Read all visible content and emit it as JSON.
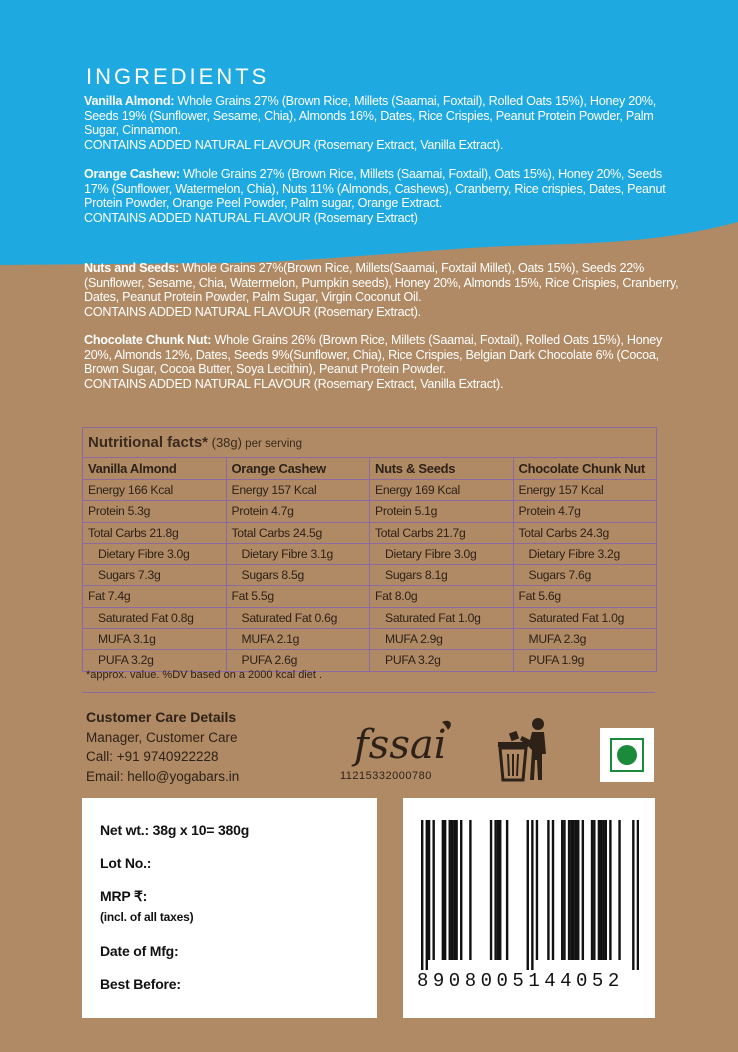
{
  "colors": {
    "blue": "#1ea9e1",
    "kraft": "#b08a64",
    "table_border": "#8c6aa0",
    "veg_green": "#1b8a3a"
  },
  "ingredients": {
    "title": "INGREDIENTS",
    "items": [
      {
        "name": "Vanilla Almond:",
        "text": " Whole Grains 27% (Brown Rice, Millets (Saamai, Foxtail), Rolled Oats 15%), Honey 20%, Seeds 19% (Sunflower, Sesame, Chia), Almonds 16%, Dates, Rice Crispies, Peanut Protein Powder, Palm Sugar, Cinnamon.",
        "contains": "CONTAINS ADDED NATURAL FLAVOUR (Rosemary Extract, Vanilla Extract)."
      },
      {
        "name": "Orange Cashew:",
        "text": " Whole Grains 27% (Brown Rice, Millets (Saamai, Foxtail), Oats 15%), Honey 20%, Seeds 17% (Sunflower, Watermelon, Chia), Nuts 11% (Almonds, Cashews), Cranberry, Rice crispies, Dates, Peanut Protein Powder, Orange Peel Powder, Palm sugar, Orange Extract.",
        "contains": "CONTAINS ADDED NATURAL FLAVOUR (Rosemary Extract)"
      },
      {
        "name": "Nuts and Seeds:",
        "text": " Whole Grains 27%(Brown Rice, Millets(Saamai, Foxtail Millet), Oats 15%), Seeds 22% (Sunflower, Sesame, Chia, Watermelon, Pumpkin seeds), Honey 20%, Almonds 15%, Rice Crispies, Cranberry, Dates, Peanut Protein Powder, Palm Sugar, Virgin Coconut Oil.",
        "contains": "CONTAINS ADDED NATURAL FLAVOUR (Rosemary Extract)."
      },
      {
        "name": "Chocolate Chunk Nut:",
        "text": " Whole Grains 26% (Brown Rice, Millets (Saamai, Foxtail), Rolled Oats 15%), Honey 20%, Almonds 12%, Dates, Seeds 9%(Sunflower, Chia), Rice Crispies, Belgian Dark Chocolate 6% (Cocoa, Brown Sugar, Cocoa Butter, Soya Lecithin), Peanut Protein Powder.",
        "contains": "CONTAINS ADDED NATURAL FLAVOUR (Rosemary Extract, Vanilla Extract)."
      }
    ]
  },
  "nutrition": {
    "title": "Nutritional facts*",
    "serving": " (38g)",
    "per": " per serving",
    "columns": [
      {
        "header": "Vanilla Almond",
        "rows": [
          "Energy 166 Kcal",
          "Protein 5.3g",
          "Total Carbs 21.8g",
          "Dietary Fibre 3.0g",
          "Sugars 7.3g",
          "Fat 7.4g",
          "Saturated Fat 0.8g",
          "MUFA 3.1g",
          "PUFA 3.2g"
        ]
      },
      {
        "header": "Orange Cashew",
        "rows": [
          "Energy 157 Kcal",
          "Protein 4.7g",
          "Total Carbs 24.5g",
          "Dietary Fibre 3.1g",
          "Sugars 8.5g",
          "Fat 5.5g",
          "Saturated Fat 0.6g",
          "MUFA 2.1g",
          "PUFA 2.6g"
        ]
      },
      {
        "header": "Nuts & Seeds",
        "rows": [
          "Energy 169 Kcal",
          "Protein 5.1g",
          "Total Carbs 21.7g",
          "Dietary Fibre 3.0g",
          "Sugars 8.1g",
          "Fat 8.0g",
          "Saturated Fat 1.0g",
          "MUFA 2.9g",
          "PUFA 3.2g"
        ]
      },
      {
        "header": "Chocolate Chunk Nut",
        "rows": [
          "Energy 157 Kcal",
          "Protein 4.7g",
          "Total Carbs 24.3g",
          "Dietary Fibre 3.2g",
          "Sugars 7.6g",
          "Fat 5.6g",
          "Saturated Fat 1.0g",
          "MUFA 2.3g",
          "PUFA 1.9g"
        ]
      }
    ],
    "footnote": "*approx. value. %DV based on a 2000 kcal diet ."
  },
  "customer_care": {
    "title": "Customer Care Details",
    "manager": "Manager, Customer Care",
    "call": "Call: +91 9740922228",
    "email": "Email: hello@yogabars.in"
  },
  "fssai": {
    "logo_text": "fssai",
    "number": "11215332000780"
  },
  "icons": {
    "bin": "dustbin-icon",
    "veg": "veg-mark-icon"
  },
  "pack_info": {
    "net_wt": "Net wt.: 38g  x  10= 380g",
    "lot": "Lot No.:",
    "mrp": "MRP ₹:",
    "mrp_note": "(incl. of all taxes)",
    "mfg": "Date of Mfg:",
    "best_before": "Best Before:"
  },
  "barcode": {
    "number": "8908005144052"
  }
}
